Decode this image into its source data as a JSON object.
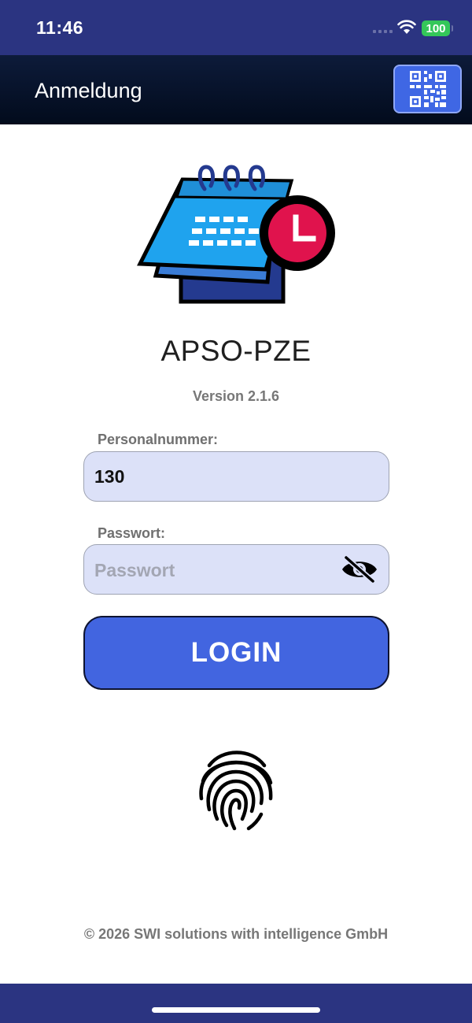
{
  "status_bar": {
    "time": "11:46",
    "battery": "100",
    "background_color": "#2b3481",
    "battery_color": "#34c759"
  },
  "nav": {
    "title": "Anmeldung",
    "qr_icon": "qr-code-icon",
    "background_color": "#020b1c",
    "qr_button_color": "#3f67e4"
  },
  "app": {
    "logo_icon": "calendar-clock-icon",
    "name": "APSO-PZE",
    "version": "Version 2.1.6"
  },
  "form": {
    "personnel_number": {
      "label": "Personalnummer:",
      "value": "130"
    },
    "password": {
      "label": "Passwort:",
      "value": "",
      "placeholder": "Passwort",
      "toggle_icon": "eye-slash-icon"
    },
    "field_background": "#dce1f8",
    "login_label": "LOGIN",
    "login_color": "#4265e0"
  },
  "biometric": {
    "icon": "fingerprint-icon"
  },
  "footer": {
    "copyright": "© 2026 SWI solutions with intelligence GmbH"
  }
}
